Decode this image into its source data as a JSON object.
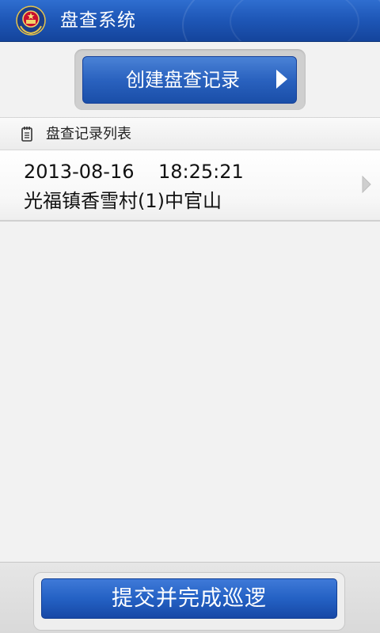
{
  "titlebar": {
    "title": "盘查系统",
    "icon": "police-emblem-icon"
  },
  "actions": {
    "create_label": "创建盘查记录",
    "create_icon": "chevron-right-icon",
    "submit_label": "提交并完成巡逻"
  },
  "section": {
    "title": "盘查记录列表",
    "icon": "notebook-icon"
  },
  "records": [
    {
      "datetime": "2013-08-16    18:25:21",
      "location": "光福镇香雪村(1)中官山",
      "icon": "chevron-right-icon"
    }
  ],
  "colors": {
    "titlebar_blue": "#1f58b8",
    "button_blue": "#2a62bf",
    "background": "#f2f2f2"
  }
}
